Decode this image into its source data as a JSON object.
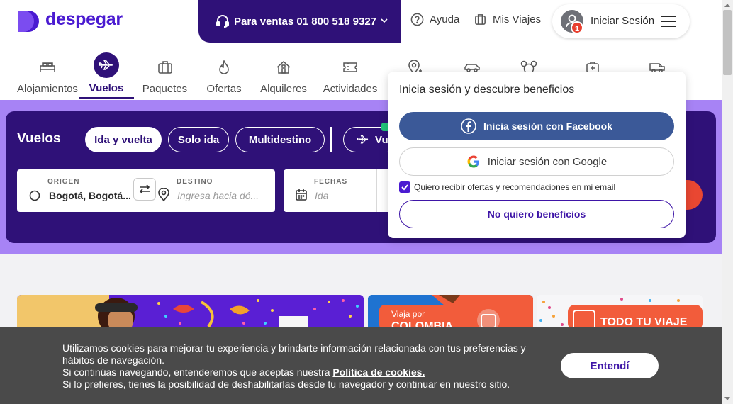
{
  "header": {
    "brand": "despegar",
    "sales": "Para ventas 01 800 518 9327",
    "help": "Ayuda",
    "trips": "Mis Viajes",
    "login": "Iniciar Sesión",
    "notification_count": "1"
  },
  "nav": {
    "items": [
      {
        "label": "Alojamientos",
        "icon": "bed-icon"
      },
      {
        "label": "Vuelos",
        "icon": "plane-icon",
        "active": true
      },
      {
        "label": "Paquetes",
        "icon": "suitcase-icon"
      },
      {
        "label": "Ofertas",
        "icon": "flame-icon"
      },
      {
        "label": "Alquileres",
        "icon": "house-icon"
      },
      {
        "label": "Actividades",
        "icon": "ticket-icon"
      },
      {
        "label": "",
        "icon": "map-pin-icon"
      },
      {
        "label": "",
        "icon": "car-icon"
      },
      {
        "label": "",
        "icon": "mickey-icon"
      },
      {
        "label": "",
        "icon": "medkit-icon"
      },
      {
        "label": "",
        "icon": "van-icon"
      }
    ]
  },
  "search": {
    "title": "Vuelos",
    "trip_types": [
      "Ida y vuelta",
      "Solo ida",
      "Multidestino"
    ],
    "selected_trip_type": "Ida y vuelta",
    "extra_chip": "Vu",
    "origin_label": "ORIGEN",
    "origin_value": "Bogotá, Bogotá...",
    "destination_label": "DESTINO",
    "destination_placeholder": "Ingresa hacia dó...",
    "dates_label": "FECHAS",
    "dates_placeholder": "Ida"
  },
  "banners": {
    "b2_line1": "Viaja por",
    "b2_line2": "COLOMBIA",
    "b3_text": "TODO TU VIAJE"
  },
  "login_popover": {
    "title": "Inicia sesión y descubre beneficios",
    "facebook": "Inicia sesión con Facebook",
    "google": "Iniciar sesión con Google",
    "consent": "Quiero recibir ofertas y recomendaciones en mi email",
    "consent_checked": true,
    "decline": "No quiero beneficios"
  },
  "cookies": {
    "line1": "Utilizamos cookies para mejorar tu experiencia y brindarte información relacionada con tus preferencias y hábitos de navegación.",
    "line2_prefix": "Si continúas navegando, entenderemos que aceptas nuestra",
    "policy_link": "Política de cookies.",
    "line3": "Si lo prefieres, tienes la posibilidad de deshabilitarlas desde tu navegador y continuar en nuestro sitio.",
    "accept": "Entendí"
  },
  "colors": {
    "brand_purple": "#4a1ad1",
    "dark_purple": "#2f1178",
    "lilac": "#a783f5",
    "accent_red": "#e94732",
    "facebook_blue": "#3b5998"
  }
}
